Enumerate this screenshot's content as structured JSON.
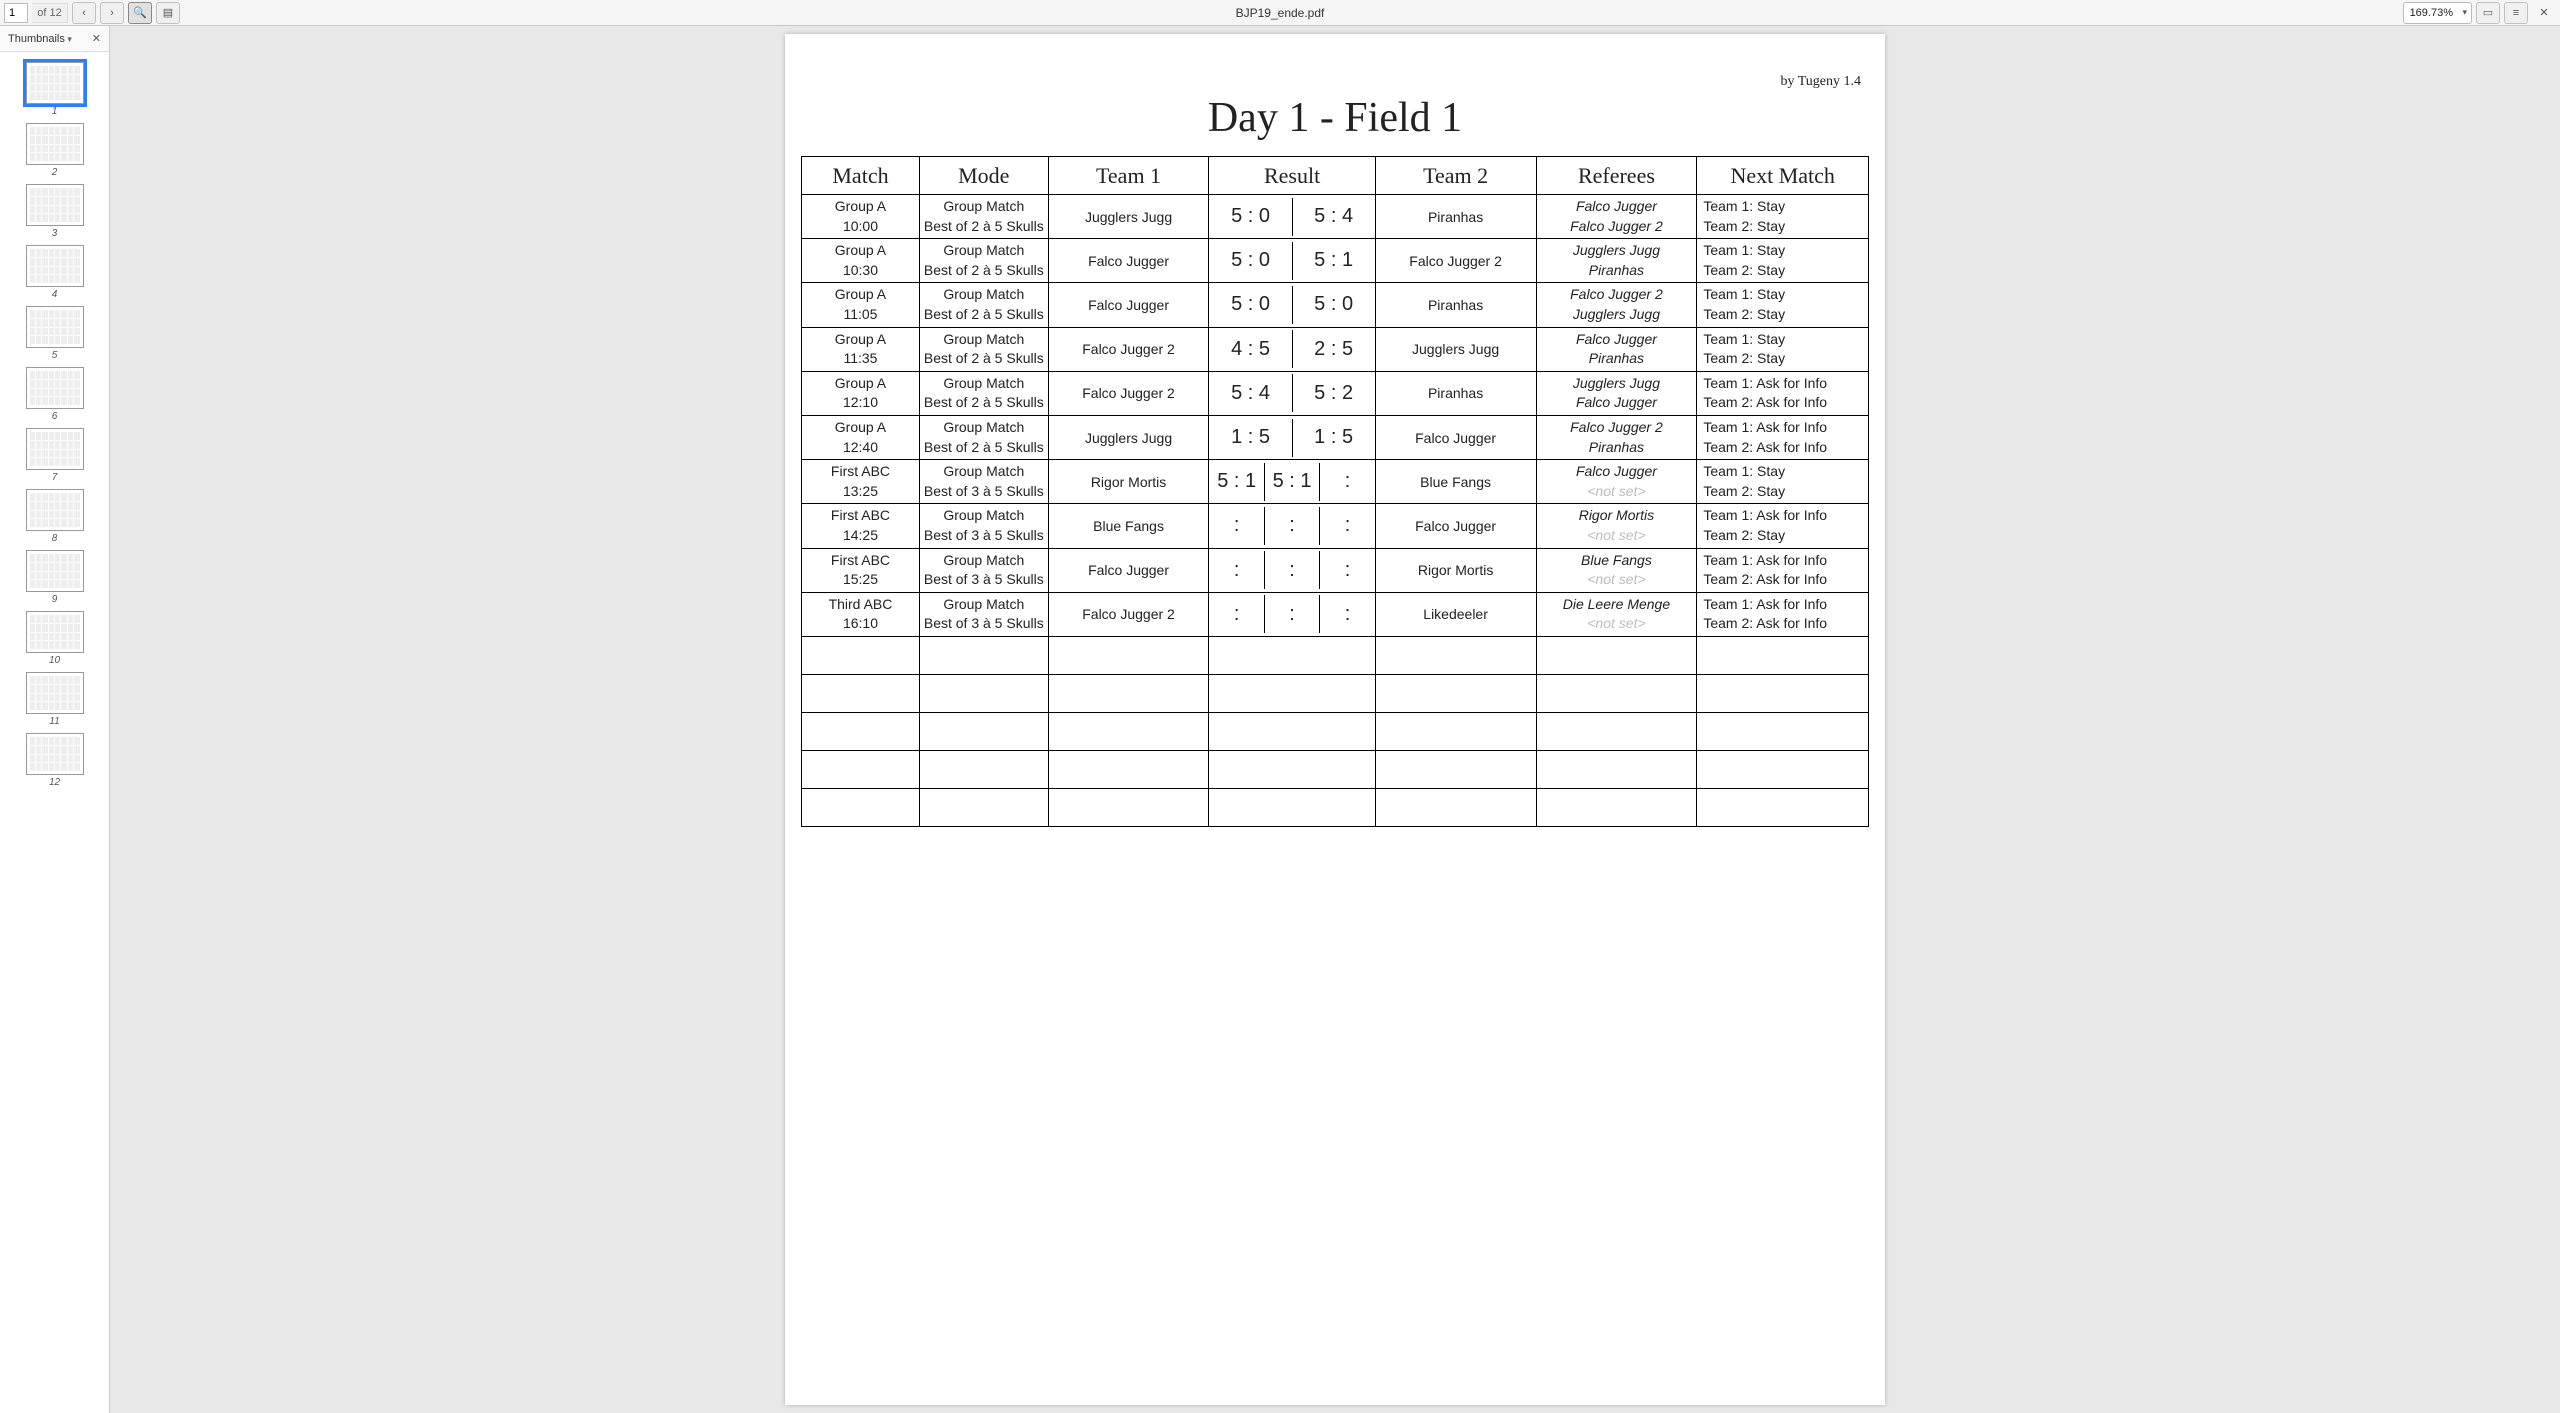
{
  "toolbar": {
    "filename": "BJP19_ende.pdf",
    "page_current": "1",
    "page_of_label": "of 12",
    "zoom_label": "169.73%"
  },
  "sidebar": {
    "label": "Thumbnails",
    "total_pages": 12,
    "selected": 1
  },
  "page": {
    "credit": "by Tugeny 1.4",
    "title": "Day 1 - Field 1",
    "headers": {
      "match": "Match",
      "mode": "Mode",
      "team1": "Team 1",
      "result": "Result",
      "team2": "Team 2",
      "referees": "Referees",
      "next": "Next Match"
    },
    "rows": [
      {
        "match_group": "Group A",
        "match_time": "10:00",
        "mode_line1": "Group Match",
        "mode_line2": "Best of 2 à 5 Skulls",
        "team1": "Jugglers Jugg",
        "scores": [
          "5 : 0",
          "5 : 4"
        ],
        "team2": "Piranhas",
        "ref1": "Falco Jugger",
        "ref2": "Falco Jugger 2",
        "ref2_notset": false,
        "next1": "Team 1: Stay",
        "next2": "Team 2: Stay"
      },
      {
        "match_group": "Group A",
        "match_time": "10:30",
        "mode_line1": "Group Match",
        "mode_line2": "Best of 2 à 5 Skulls",
        "team1": "Falco Jugger",
        "scores": [
          "5 : 0",
          "5 : 1"
        ],
        "team2": "Falco Jugger 2",
        "ref1": "Jugglers Jugg",
        "ref2": "Piranhas",
        "ref2_notset": false,
        "next1": "Team 1: Stay",
        "next2": "Team 2: Stay"
      },
      {
        "match_group": "Group A",
        "match_time": "11:05",
        "mode_line1": "Group Match",
        "mode_line2": "Best of 2 à 5 Skulls",
        "team1": "Falco Jugger",
        "scores": [
          "5 : 0",
          "5 : 0"
        ],
        "team2": "Piranhas",
        "ref1": "Falco Jugger 2",
        "ref2": "Jugglers Jugg",
        "ref2_notset": false,
        "next1": "Team 1: Stay",
        "next2": "Team 2: Stay"
      },
      {
        "match_group": "Group A",
        "match_time": "11:35",
        "mode_line1": "Group Match",
        "mode_line2": "Best of 2 à 5 Skulls",
        "team1": "Falco Jugger 2",
        "scores": [
          "4 : 5",
          "2 : 5"
        ],
        "team2": "Jugglers Jugg",
        "ref1": "Falco Jugger",
        "ref2": "Piranhas",
        "ref2_notset": false,
        "next1": "Team 1: Stay",
        "next2": "Team 2: Stay"
      },
      {
        "match_group": "Group A",
        "match_time": "12:10",
        "mode_line1": "Group Match",
        "mode_line2": "Best of 2 à 5 Skulls",
        "team1": "Falco Jugger 2",
        "scores": [
          "5 : 4",
          "5 : 2"
        ],
        "team2": "Piranhas",
        "ref1": "Jugglers Jugg",
        "ref2": "Falco Jugger",
        "ref2_notset": false,
        "next1": "Team 1: Ask for Info",
        "next2": "Team 2: Ask for Info"
      },
      {
        "match_group": "Group A",
        "match_time": "12:40",
        "mode_line1": "Group Match",
        "mode_line2": "Best of 2 à 5 Skulls",
        "team1": "Jugglers Jugg",
        "scores": [
          "1 : 5",
          "1 : 5"
        ],
        "team2": "Falco Jugger",
        "ref1": "Falco Jugger 2",
        "ref2": "Piranhas",
        "ref2_notset": false,
        "next1": "Team 1: Ask for Info",
        "next2": "Team 2: Ask for Info"
      },
      {
        "match_group": "First ABC",
        "match_time": "13:25",
        "mode_line1": "Group Match",
        "mode_line2": "Best of 3 à 5 Skulls",
        "team1": "Rigor Mortis",
        "scores": [
          "5 : 1",
          "5 : 1",
          ":"
        ],
        "team2": "Blue Fangs",
        "ref1": "Falco Jugger",
        "ref2": "<not set>",
        "ref2_notset": true,
        "next1": "Team 1: Stay",
        "next2": "Team 2: Stay"
      },
      {
        "match_group": "First ABC",
        "match_time": "14:25",
        "mode_line1": "Group Match",
        "mode_line2": "Best of 3 à 5 Skulls",
        "team1": "Blue Fangs",
        "scores": [
          ":",
          ":",
          ":"
        ],
        "team2": "Falco Jugger",
        "ref1": "Rigor Mortis",
        "ref2": "<not set>",
        "ref2_notset": true,
        "next1": "Team 1: Ask for Info",
        "next2": "Team 2: Stay"
      },
      {
        "match_group": "First ABC",
        "match_time": "15:25",
        "mode_line1": "Group Match",
        "mode_line2": "Best of 3 à 5 Skulls",
        "team1": "Falco Jugger",
        "scores": [
          ":",
          ":",
          ":"
        ],
        "team2": "Rigor Mortis",
        "ref1": "Blue Fangs",
        "ref2": "<not set>",
        "ref2_notset": true,
        "next1": "Team 1: Ask for Info",
        "next2": "Team 2: Ask for Info"
      },
      {
        "match_group": "Third ABC",
        "match_time": "16:10",
        "mode_line1": "Group Match",
        "mode_line2": "Best of 3 à 5 Skulls",
        "team1": "Falco Jugger 2",
        "scores": [
          ":",
          ":",
          ":"
        ],
        "team2": "Likedeeler",
        "ref1": "Die Leere Menge",
        "ref2": "<not set>",
        "ref2_notset": true,
        "next1": "Team 1: Ask for Info",
        "next2": "Team 2: Ask for Info"
      }
    ],
    "empty_rows": 5
  }
}
